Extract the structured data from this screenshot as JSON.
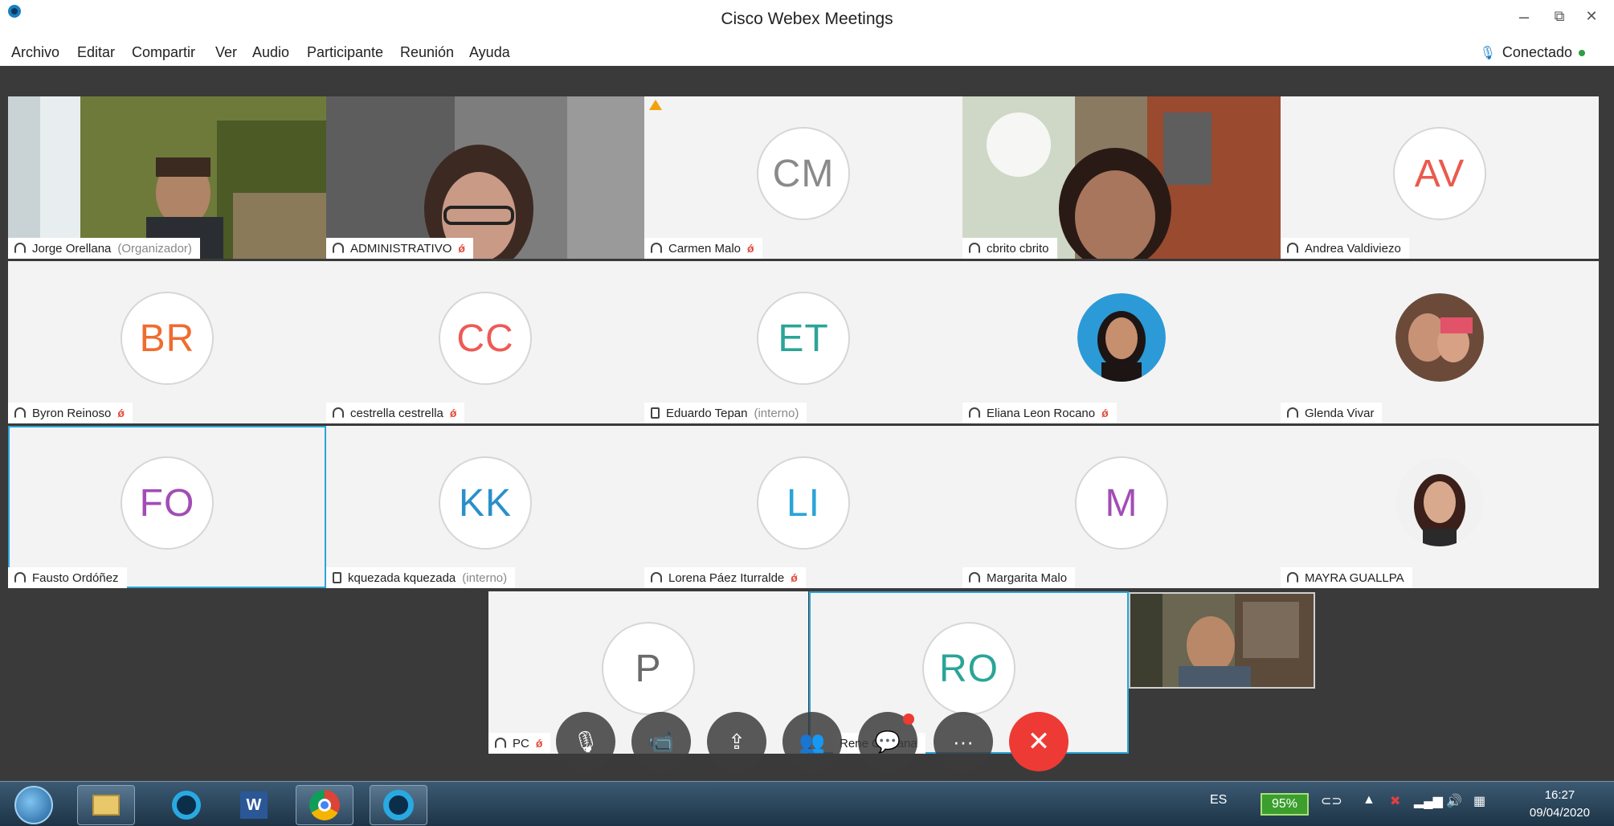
{
  "window": {
    "title": "Cisco Webex Meetings",
    "minimize": "–",
    "restore": "⧉",
    "close": "✕"
  },
  "menu": [
    "Archivo",
    "Editar",
    "Compartir",
    "Ver",
    "Audio",
    "Participante",
    "Reunión",
    "Ayuda"
  ],
  "status": {
    "label": "Conectado"
  },
  "participants": [
    {
      "name": "Jorge Orellana",
      "note": "(Organizador)",
      "initials": "",
      "kind": "video",
      "muted": false,
      "audio": "headset"
    },
    {
      "name": "ADMINISTRATIVO",
      "note": "",
      "initials": "",
      "kind": "video",
      "muted": true,
      "audio": "headset"
    },
    {
      "name": "Carmen Malo",
      "note": "",
      "initials": "CM",
      "kind": "initials",
      "color": "#8a8a8a",
      "muted": true,
      "audio": "headset",
      "warning": true
    },
    {
      "name": "cbrito cbrito",
      "note": "",
      "initials": "",
      "kind": "video",
      "muted": false,
      "audio": "headset"
    },
    {
      "name": "Andrea Valdiviezo",
      "note": "",
      "initials": "AV",
      "kind": "initials",
      "color": "#ea5a4f",
      "muted": false,
      "audio": "headset"
    },
    {
      "name": "Byron Reinoso",
      "note": "",
      "initials": "BR",
      "kind": "initials",
      "color": "#ef6c2e",
      "muted": true,
      "audio": "headset"
    },
    {
      "name": "cestrella cestrella",
      "note": "",
      "initials": "CC",
      "kind": "initials",
      "color": "#ee5a55",
      "muted": true,
      "audio": "headset"
    },
    {
      "name": "Eduardo Tepan",
      "note": "(interno)",
      "initials": "ET",
      "kind": "initials",
      "color": "#2aa597",
      "muted": false,
      "audio": "phone"
    },
    {
      "name": "Eliana Leon Rocano",
      "note": "",
      "initials": "",
      "kind": "photo",
      "muted": true,
      "audio": "headset"
    },
    {
      "name": "Glenda Vivar",
      "note": "",
      "initials": "",
      "kind": "photo",
      "muted": false,
      "audio": "headset"
    },
    {
      "name": "Fausto Ordóñez",
      "note": "",
      "initials": "FO",
      "kind": "initials",
      "color": "#a24db5",
      "muted": false,
      "audio": "headset",
      "selected": true
    },
    {
      "name": "kquezada kquezada",
      "note": "(interno)",
      "initials": "KK",
      "kind": "initials",
      "color": "#2a90c9",
      "muted": false,
      "audio": "phone"
    },
    {
      "name": "Lorena Páez Iturralde",
      "note": "",
      "initials": "LI",
      "kind": "initials",
      "color": "#2aa4d9",
      "muted": true,
      "audio": "headset"
    },
    {
      "name": "Margarita Malo",
      "note": "",
      "initials": "M",
      "kind": "initials",
      "color": "#a24db5",
      "muted": false,
      "audio": "headset"
    },
    {
      "name": "MAYRA GUALLPA",
      "note": "",
      "initials": "",
      "kind": "photo",
      "muted": false,
      "audio": "headset"
    }
  ],
  "bottom_row": [
    {
      "name": "PC",
      "initials": "P",
      "color": "#6a6a6a",
      "muted": true
    },
    {
      "name": "Rene Orellana",
      "initials": "RO",
      "color": "#2aa597",
      "muted": false
    }
  ],
  "controls": {
    "mute": "🎙",
    "video": "📹",
    "share": "⇪",
    "participants": "👥",
    "chat": "💬",
    "more": "···",
    "end": "✕"
  },
  "taskbar": {
    "language": "ES",
    "battery": "95%",
    "time": "16:27",
    "date": "09/04/2020"
  }
}
